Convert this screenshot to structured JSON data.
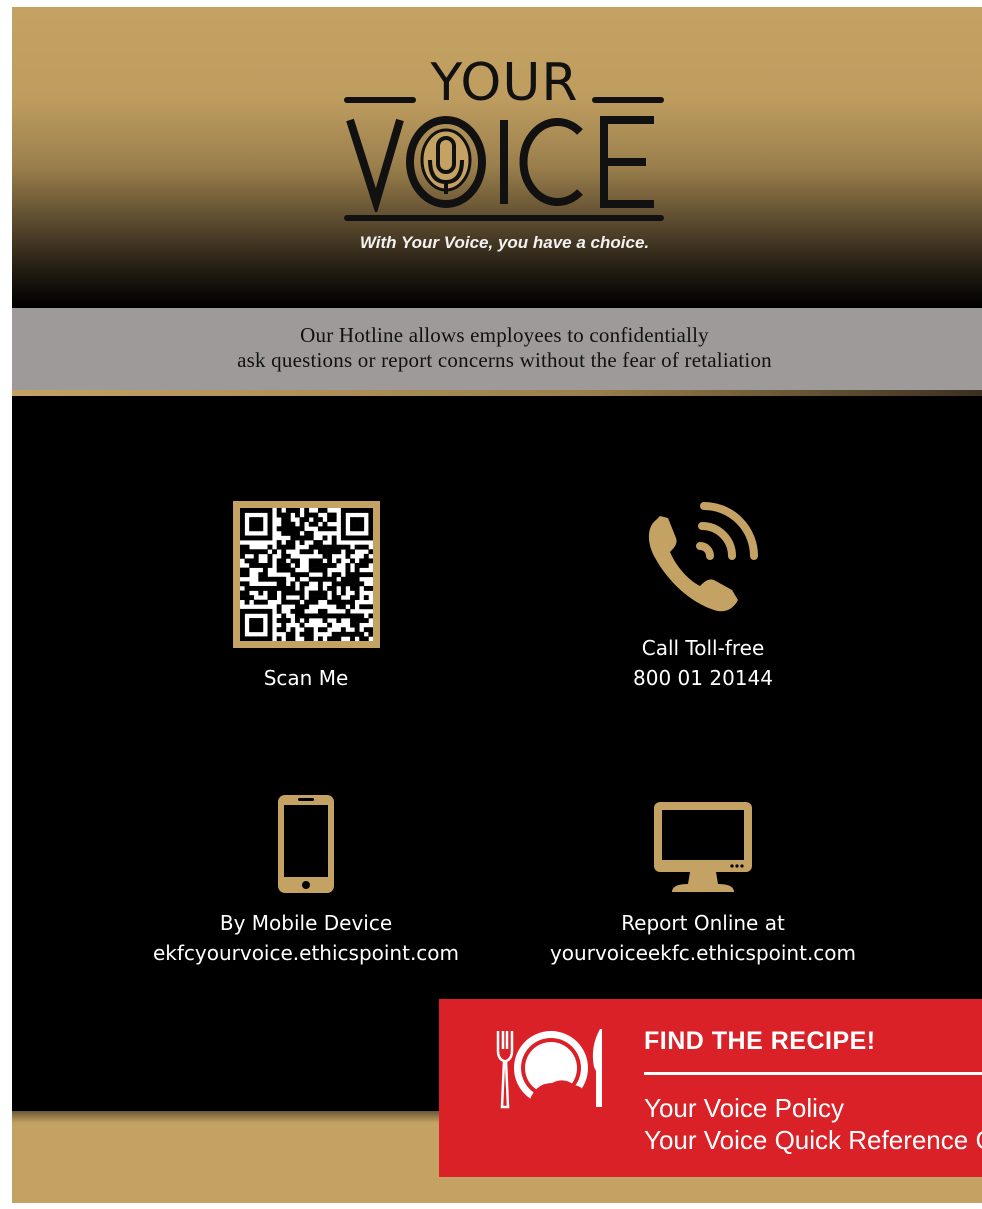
{
  "header": {
    "logo_top": "YOUR",
    "logo_bottom": "VOICE",
    "tagline": "With Your Voice, you have a choice."
  },
  "banner": {
    "line1": "Our Hotline allows employees to confidentially",
    "line2": "ask questions or report concerns without the fear of retaliation"
  },
  "contact": {
    "qr": {
      "icon": "qr-code",
      "label": "Scan Me"
    },
    "phone": {
      "icon": "phone-icon",
      "label": "Call Toll-free",
      "number": "800 01 20144"
    },
    "mobile": {
      "icon": "smartphone-icon",
      "label": "By Mobile Device",
      "url": "ekfcyourvoice.ethicspoint.com"
    },
    "online": {
      "icon": "monitor-icon",
      "label": "Report Online at",
      "url": "yourvoiceekfc.ethicspoint.com"
    }
  },
  "recipe": {
    "icon": "plate-cutlery-icon",
    "title": "FIND THE RECIPE!",
    "links": [
      "Your Voice Policy",
      "Your Voice Quick Reference Gu"
    ]
  },
  "colors": {
    "gold": "#c4a263",
    "red": "#da2128",
    "grey": "#9d9a99",
    "black": "#000000"
  }
}
